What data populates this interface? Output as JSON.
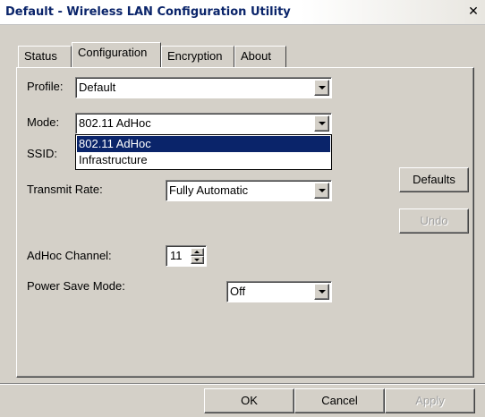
{
  "window": {
    "title": "Default - Wireless LAN Configuration Utility",
    "close_glyph": "✕"
  },
  "tabs": [
    {
      "label": "Status"
    },
    {
      "label": "Configuration"
    },
    {
      "label": "Encryption"
    },
    {
      "label": "About"
    }
  ],
  "active_tab": "Configuration",
  "form": {
    "profile": {
      "label": "Profile:",
      "value": "Default"
    },
    "mode": {
      "label": "Mode:",
      "value": "802.11 AdHoc"
    },
    "mode_options": [
      "802.11 AdHoc",
      "Infrastructure"
    ],
    "mode_selected_option": "802.11 AdHoc",
    "ssid": {
      "label": "SSID:"
    },
    "transmit_rate": {
      "label": "Transmit Rate:",
      "value": "Fully Automatic"
    },
    "adhoc_channel": {
      "label": "AdHoc Channel:",
      "value": "11"
    },
    "power_save_mode": {
      "label": "Power Save Mode:",
      "value": "Off"
    }
  },
  "side_buttons": {
    "defaults": "Defaults",
    "undo": "Undo"
  },
  "bottom_buttons": {
    "ok": "OK",
    "cancel": "Cancel",
    "apply": "Apply"
  },
  "colors": {
    "title_text": "#0a246a",
    "selection_bg": "#0a246a",
    "dialog_bg": "#d4d0c8",
    "disabled_text": "#a0a0a0"
  },
  "icons": {
    "dropdown_arrow": "chevron-down-icon",
    "close": "close-icon",
    "spin_up": "spin-up-icon",
    "spin_down": "spin-down-icon"
  }
}
